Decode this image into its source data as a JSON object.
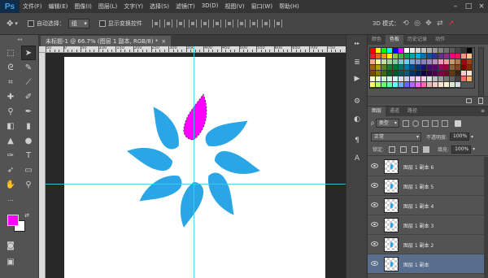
{
  "app": {
    "logo": "Ps"
  },
  "menu": [
    "文件(F)",
    "编辑(E)",
    "图像(I)",
    "图层(L)",
    "文字(Y)",
    "选择(S)",
    "滤镜(T)",
    "3D(D)",
    "视图(V)",
    "窗口(W)",
    "帮助(H)"
  ],
  "window_controls": {
    "minimize": "–",
    "maximize": "□",
    "close": "×"
  },
  "options": {
    "auto_select_label": "自动选择：",
    "auto_select_value": "组",
    "show_transform_label": "显示变换控件",
    "mode3d_label": "3D 模式："
  },
  "document": {
    "tab_title": "未标题-1 @ 66.7% (图层 1 副本, RGB/8) *",
    "close": "×"
  },
  "ruler": {
    "top_marks": [
      "50",
      "0",
      "50",
      "100",
      "150",
      "200",
      "250",
      "300",
      "350",
      "400",
      "450",
      "500",
      "550",
      "600",
      "650",
      "700",
      "750"
    ]
  },
  "colors": {
    "foreground": "#ff00ff",
    "background": "#ffffff",
    "petal": "#2aa6e6",
    "selected_petal": "#ff00ff",
    "guide": "#30d7e8"
  },
  "swatch_panel": {
    "tabs": [
      "颜色",
      "色板",
      "历史记录",
      "动作"
    ],
    "active_tab": "色板"
  },
  "swatches": [
    "#ff0000",
    "#ffff00",
    "#00ff00",
    "#00ffff",
    "#0000ff",
    "#ff00ff",
    "#ffffff",
    "#ebebeb",
    "#d6d6d6",
    "#c2c2c2",
    "#adadad",
    "#999999",
    "#858585",
    "#707070",
    "#5c5c5c",
    "#474747",
    "#333333",
    "#000000",
    "#ed1c24",
    "#f26522",
    "#f7941d",
    "#fff200",
    "#8dc63f",
    "#39b54a",
    "#00a651",
    "#00a99d",
    "#00aeef",
    "#0072bc",
    "#0054a6",
    "#2e3192",
    "#662d91",
    "#92278f",
    "#ec008c",
    "#ed145b",
    "#f7977a",
    "#fdc68a",
    "#f9ad81",
    "#fff799",
    "#c4df9b",
    "#a3d39c",
    "#82ca9c",
    "#7accc8",
    "#6dcff6",
    "#7da7d9",
    "#8493ca",
    "#8882be",
    "#a187be",
    "#bc8dbf",
    "#f49ac2",
    "#f6989d",
    "#c69c6d",
    "#a67c52",
    "#9e0b0f",
    "#a0410d",
    "#a36209",
    "#aba000",
    "#598527",
    "#1a7b30",
    "#007236",
    "#00746b",
    "#0076a3",
    "#004b80",
    "#003471",
    "#1b1464",
    "#440e62",
    "#630460",
    "#9e005d",
    "#9e0039",
    "#8c6239",
    "#754c24",
    "#790000",
    "#7b2e00",
    "#7d4900",
    "#827b00",
    "#406618",
    "#005e20",
    "#005826",
    "#005952",
    "#005b7f",
    "#003663",
    "#002157",
    "#0d004c",
    "#32004b",
    "#4b0049",
    "#7b0046",
    "#7a0026",
    "#603913",
    "#3c2415",
    "#ffcccc",
    "#ffe5cc",
    "#ffffcc",
    "#e5ffcc",
    "#ccffcc",
    "#ccffe5",
    "#ccffff",
    "#cce5ff",
    "#ccccff",
    "#e5ccff",
    "#ffccff",
    "#ffcce5",
    "#e0e0e0",
    "#bdbdbd",
    "#9e9e9e",
    "#757575",
    "#616161",
    "#424242",
    "#ff6666",
    "#ffb266",
    "#ffff66",
    "#b2ff66",
    "#66ff66",
    "#66ffb2",
    "#66ffff",
    "#66b2ff",
    "#6666ff",
    "#b266ff",
    "#ff66ff",
    "#ff66b2",
    "#e6b8af",
    "#f4cccc",
    "#fce5cd",
    "#fff2cc",
    "#d9ead3",
    "#d0e0e3"
  ],
  "layers_panel": {
    "tabs": [
      "图层",
      "通道",
      "路径"
    ],
    "active_tab": "图层",
    "menu_icon": "≡",
    "filter_value": "类型",
    "blend_mode": "正常",
    "opacity_label": "不透明度:",
    "opacity_value": "100%",
    "lock_label": "锁定:",
    "fill_label": "填充:",
    "fill_value": "100%",
    "layers": [
      {
        "name": "图层 1 副本 6",
        "selected": false
      },
      {
        "name": "图层 1 副本 5",
        "selected": false
      },
      {
        "name": "图层 1 副本 4",
        "selected": false
      },
      {
        "name": "图层 1 副本 3",
        "selected": false
      },
      {
        "name": "图层 1 副本 2",
        "selected": false
      },
      {
        "name": "图层 1 副本",
        "selected": true
      }
    ]
  }
}
